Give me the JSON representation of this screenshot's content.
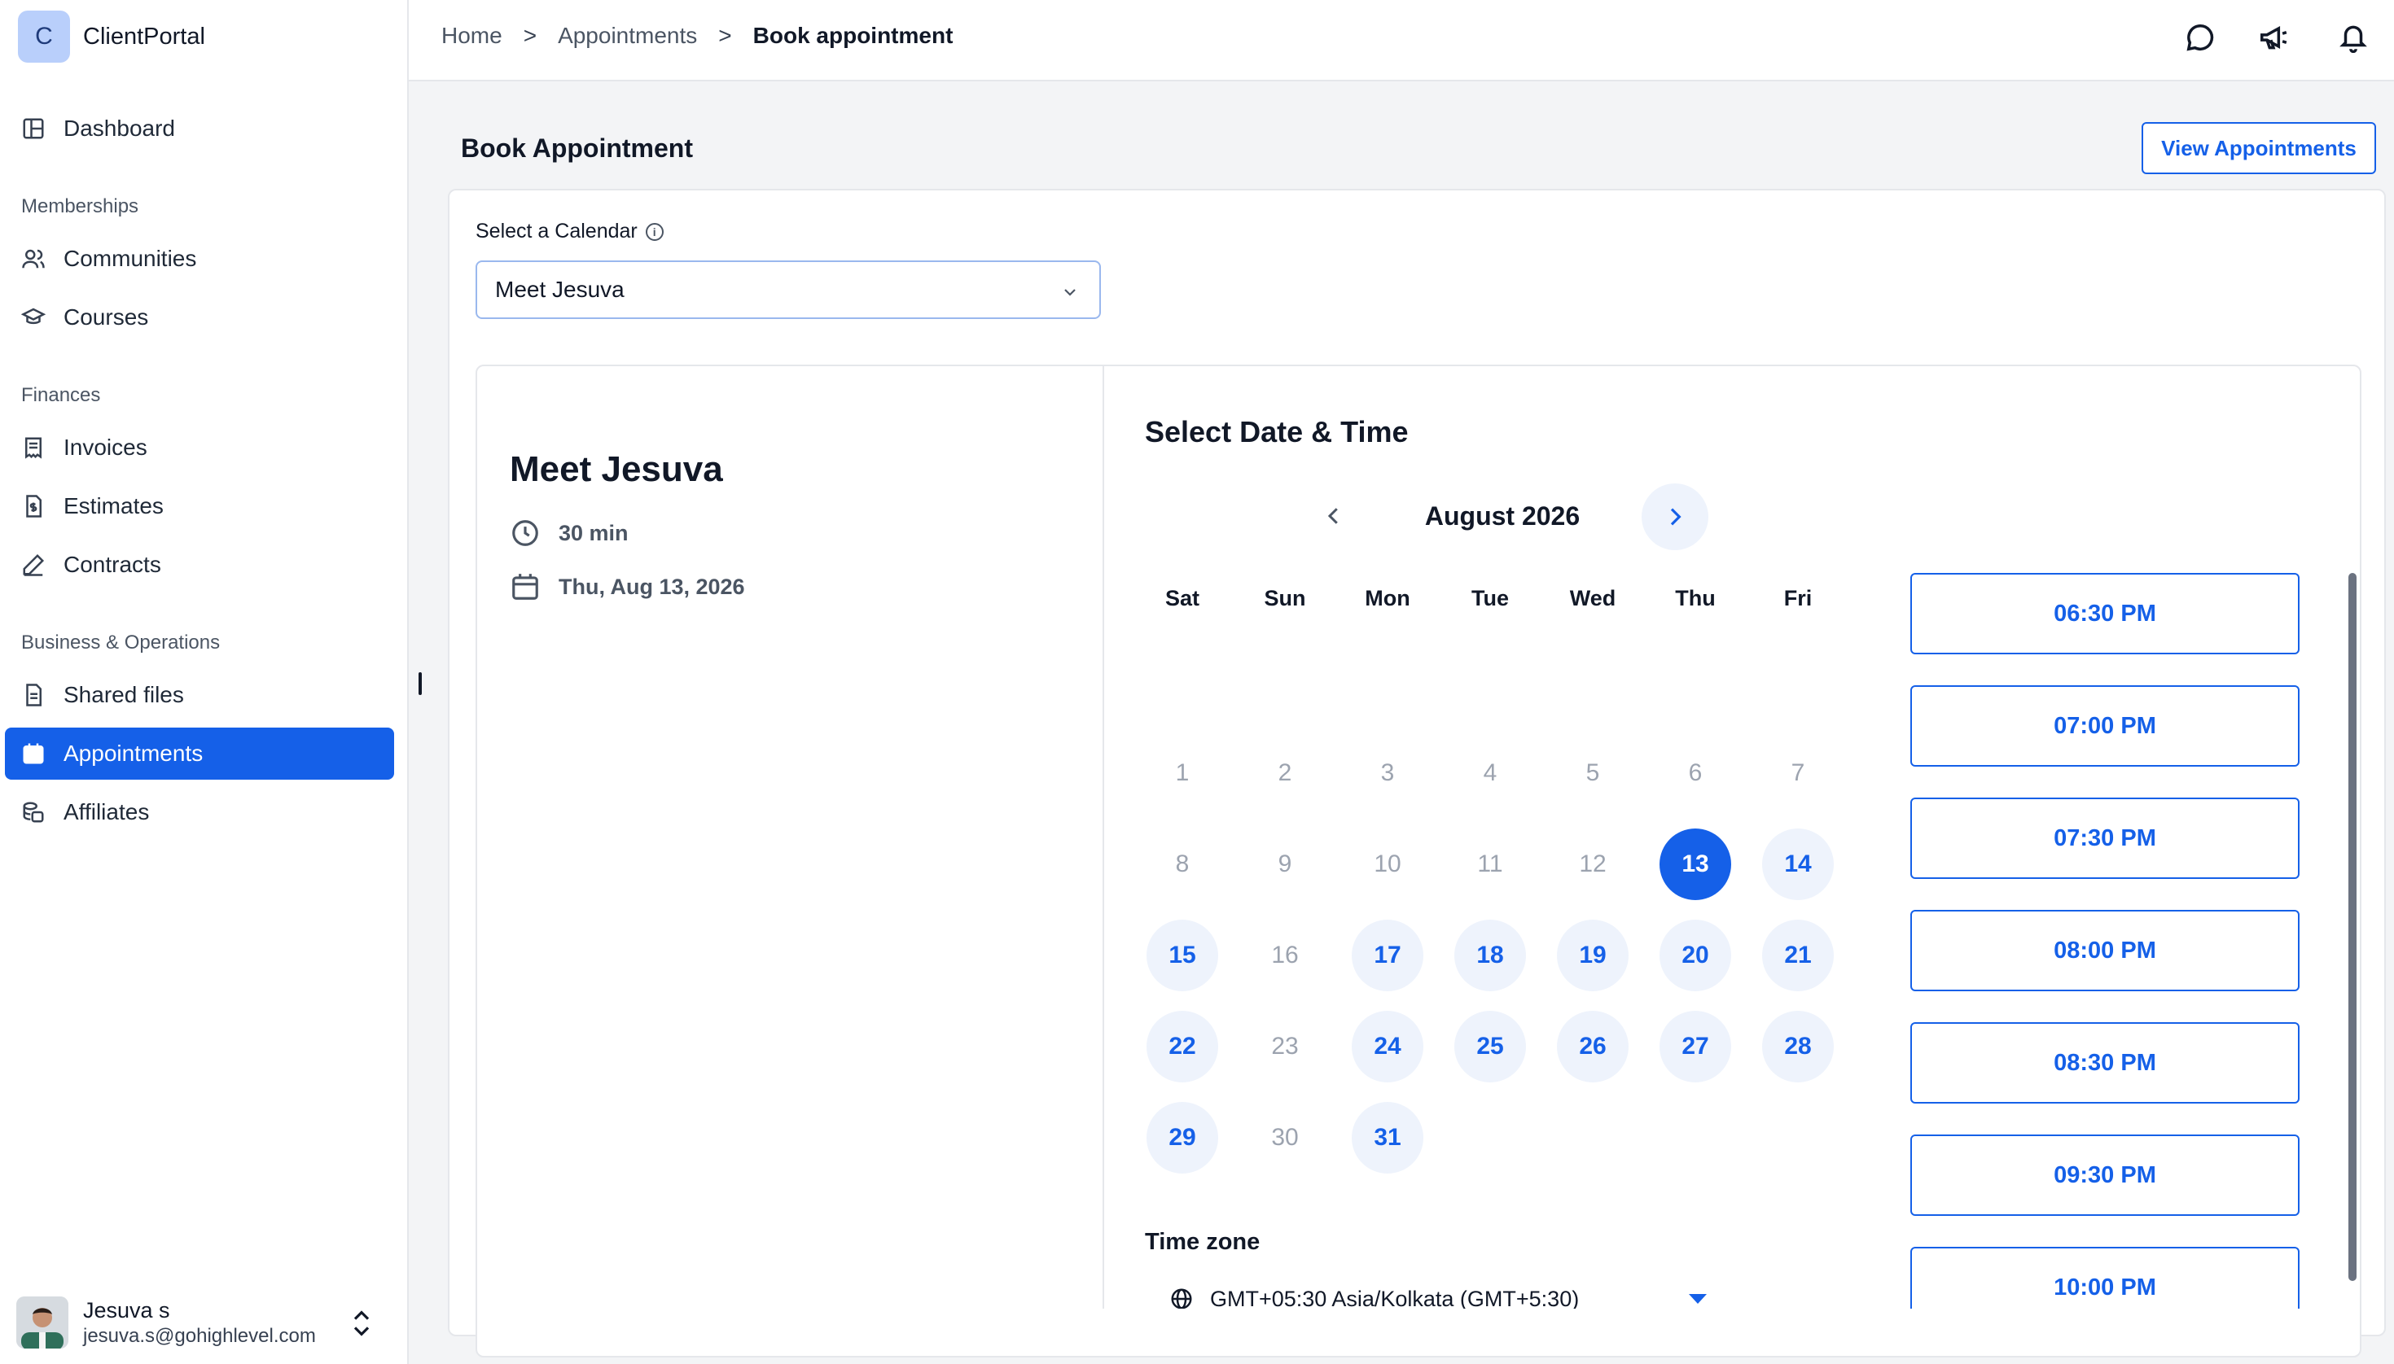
{
  "brand": {
    "initial": "C",
    "name": "ClientPortal"
  },
  "sidebar": {
    "dashboard": "Dashboard",
    "sections": {
      "memberships": "Memberships",
      "finances": "Finances",
      "business": "Business & Operations"
    },
    "items": [
      {
        "label": "Communities",
        "icon": "users-icon"
      },
      {
        "label": "Courses",
        "icon": "graduation-cap-icon"
      },
      {
        "label": "Invoices",
        "icon": "receipt-icon"
      },
      {
        "label": "Estimates",
        "icon": "dollar-document-icon"
      },
      {
        "label": "Contracts",
        "icon": "pen-icon"
      },
      {
        "label": "Shared files",
        "icon": "file-icon"
      },
      {
        "label": "Appointments",
        "icon": "calendar-icon",
        "active": true
      },
      {
        "label": "Affiliates",
        "icon": "coins-icon"
      }
    ]
  },
  "user": {
    "name": "Jesuva s",
    "email": "jesuva.s@gohighlevel.com"
  },
  "breadcrumb": {
    "home": "Home",
    "appointments": "Appointments",
    "current": "Book appointment",
    "separator": ">"
  },
  "page": {
    "title": "Book Appointment",
    "view_button": "View Appointments"
  },
  "calendar_select": {
    "label": "Select a Calendar",
    "value": "Meet Jesuva"
  },
  "event": {
    "title": "Meet Jesuva",
    "duration": "30 min",
    "date": "Thu, Aug 13, 2026"
  },
  "schedule": {
    "title": "Select Date & Time",
    "month": "August 2026",
    "weekdays": [
      "Sat",
      "Sun",
      "Mon",
      "Tue",
      "Wed",
      "Thu",
      "Fri"
    ],
    "days": [
      {
        "n": "1",
        "state": "disabled"
      },
      {
        "n": "2",
        "state": "disabled"
      },
      {
        "n": "3",
        "state": "disabled"
      },
      {
        "n": "4",
        "state": "disabled"
      },
      {
        "n": "5",
        "state": "disabled"
      },
      {
        "n": "6",
        "state": "disabled"
      },
      {
        "n": "7",
        "state": "disabled"
      },
      {
        "n": "8",
        "state": "disabled"
      },
      {
        "n": "9",
        "state": "disabled"
      },
      {
        "n": "10",
        "state": "disabled"
      },
      {
        "n": "11",
        "state": "disabled"
      },
      {
        "n": "12",
        "state": "disabled"
      },
      {
        "n": "13",
        "state": "selected"
      },
      {
        "n": "14",
        "state": "available"
      },
      {
        "n": "15",
        "state": "available"
      },
      {
        "n": "16",
        "state": "disabled"
      },
      {
        "n": "17",
        "state": "available"
      },
      {
        "n": "18",
        "state": "available"
      },
      {
        "n": "19",
        "state": "available"
      },
      {
        "n": "20",
        "state": "available"
      },
      {
        "n": "21",
        "state": "available"
      },
      {
        "n": "22",
        "state": "available"
      },
      {
        "n": "23",
        "state": "disabled"
      },
      {
        "n": "24",
        "state": "available"
      },
      {
        "n": "25",
        "state": "available"
      },
      {
        "n": "26",
        "state": "available"
      },
      {
        "n": "27",
        "state": "available"
      },
      {
        "n": "28",
        "state": "available"
      },
      {
        "n": "29",
        "state": "available"
      },
      {
        "n": "30",
        "state": "disabled"
      },
      {
        "n": "31",
        "state": "available"
      }
    ],
    "timezone_label": "Time zone",
    "timezone": "GMT+05:30 Asia/Kolkata (GMT+5:30)",
    "slots": [
      "06:30 PM",
      "07:00 PM",
      "07:30 PM",
      "08:00 PM",
      "08:30 PM",
      "09:30 PM",
      "10:00 PM"
    ]
  },
  "colors": {
    "accent": "#1560e8",
    "available_bg": "#eef3fc",
    "disabled_text": "#9ca3af"
  }
}
